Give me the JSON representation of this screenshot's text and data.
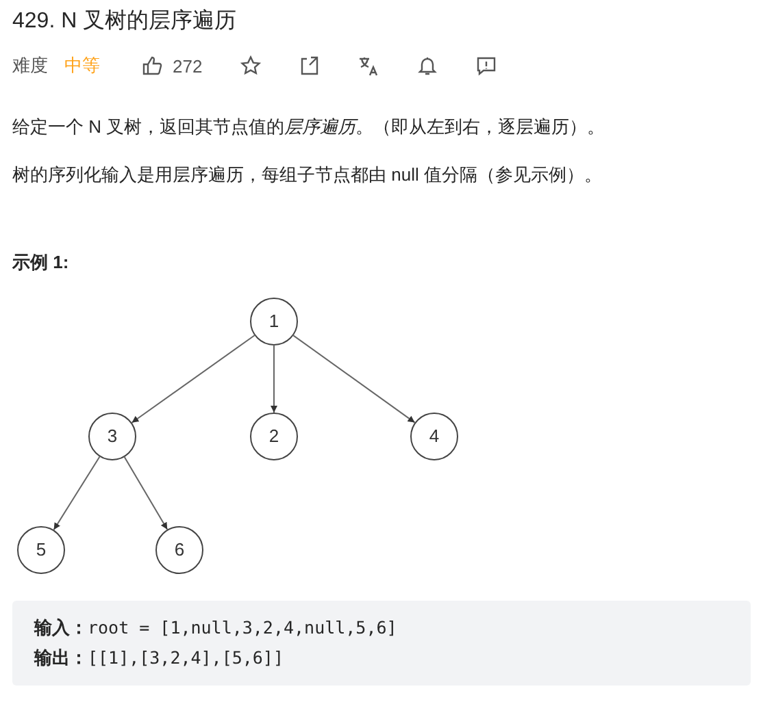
{
  "title": "429. N 叉树的层序遍历",
  "meta": {
    "difficulty_label": "难度",
    "difficulty": "中等",
    "likes": "272"
  },
  "paragraphs": [
    [
      {
        "text": "给定一个 N 叉树，返回其节点值的",
        "italic": false
      },
      {
        "text": "层序遍历",
        "italic": true
      },
      {
        "text": "。（即从左到右，逐层遍历）。",
        "italic": false
      }
    ],
    [
      {
        "text": "树的序列化输入是用层序遍历，每组子节点都由 null 值分隔（参见示例）。",
        "italic": false
      }
    ]
  ],
  "example_heading": "示例 1:",
  "tree": {
    "label": "1",
    "children": [
      {
        "label": "3",
        "children": [
          {
            "label": "5"
          },
          {
            "label": "6"
          }
        ]
      },
      {
        "label": "2"
      },
      {
        "label": "4"
      }
    ]
  },
  "example": [
    {
      "label": "输入：",
      "value": "root = [1,null,3,2,4,null,5,6]"
    },
    {
      "label": "输出：",
      "value": "[[1],[3,2,4],[5,6]]"
    }
  ]
}
